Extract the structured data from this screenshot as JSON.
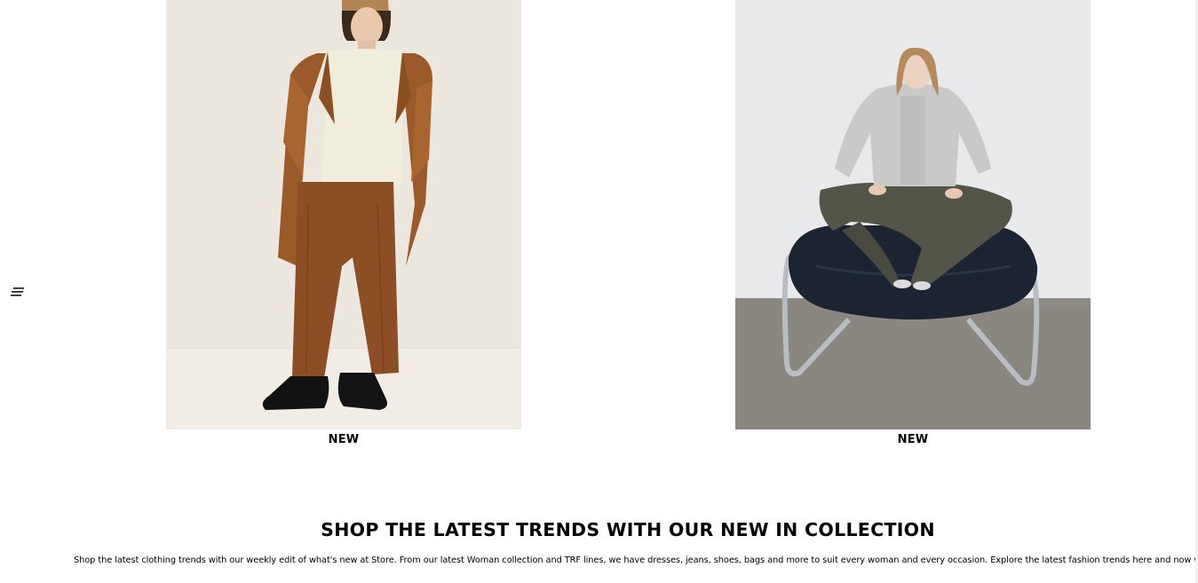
{
  "menu": {
    "icon": "hamburger-menu-icon"
  },
  "products": [
    {
      "tag": "NEW",
      "image": "man-in-camel-coat-and-brown-trousers-photo"
    },
    {
      "tag": "NEW",
      "image": "woman-in-grey-knit-seated-in-leather-chair-photo"
    }
  ],
  "promo": {
    "title": "SHOP THE LATEST TRENDS WITH OUR NEW IN COLLECTION",
    "text": "Shop the latest clothing trends with our weekly edit of what's new at Store. From our latest Woman collection and TRF lines, we have dresses, jeans, shoes, bags and more to suit every woman and every occasion. Explore the latest fashion trends here and now with us."
  },
  "colors": {
    "background": "#ffffff",
    "text": "#000000",
    "photo_left_bg": "#ebe6dc",
    "photo_right_bg": "#e7e8ea"
  }
}
